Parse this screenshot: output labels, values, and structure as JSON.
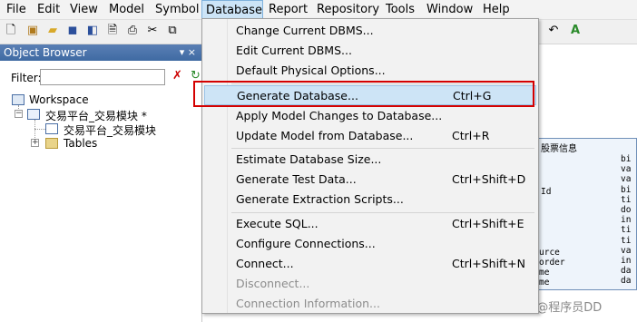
{
  "menubar": {
    "items": [
      "File",
      "Edit",
      "View",
      "Model",
      "Symbol",
      "Database",
      "Report",
      "Repository",
      "Tools",
      "Window",
      "Help"
    ]
  },
  "object_browser": {
    "title": "Object Browser",
    "pin": "▾ ×",
    "filter_label": "Filter:",
    "filter_value": "",
    "tree": {
      "workspace": "Workspace",
      "model": "交易平台_交易模块 *",
      "diagram": "交易平台_交易模块",
      "tables": "Tables"
    }
  },
  "database_menu": {
    "items": [
      {
        "label": "Change Current DBMS...",
        "shortcut": ""
      },
      {
        "label": "Edit Current DBMS...",
        "shortcut": ""
      },
      {
        "label": "Default Physical Options...",
        "shortcut": ""
      },
      {
        "label": "Generate Database...",
        "shortcut": "Ctrl+G"
      },
      {
        "label": "Apply Model Changes to Database...",
        "shortcut": ""
      },
      {
        "label": "Update Model from Database...",
        "shortcut": "Ctrl+R"
      },
      {
        "label": "Estimate Database Size...",
        "shortcut": ""
      },
      {
        "label": "Generate Test Data...",
        "shortcut": "Ctrl+Shift+D"
      },
      {
        "label": "Generate Extraction Scripts...",
        "shortcut": ""
      },
      {
        "label": "Execute SQL...",
        "shortcut": "Ctrl+Shift+E"
      },
      {
        "label": "Configure Connections...",
        "shortcut": ""
      },
      {
        "label": "Connect...",
        "shortcut": "Ctrl+Shift+N"
      },
      {
        "label": "Disconnect...",
        "shortcut": ""
      },
      {
        "label": "Connection Information...",
        "shortcut": ""
      }
    ]
  },
  "diagram": {
    "table_title": "股票信息",
    "col_types": [
      "bi",
      "va",
      "va",
      "bi",
      "ti",
      "do",
      "in",
      "ti",
      "ti",
      "va",
      "in",
      "da",
      "da"
    ],
    "col_names": [
      "Id",
      "urce",
      "order",
      "me",
      "me"
    ]
  },
  "watermark": "CSDN @程序员DD",
  "colors": {
    "highlight": "#cde4f6",
    "annotation_red": "#d40000"
  }
}
